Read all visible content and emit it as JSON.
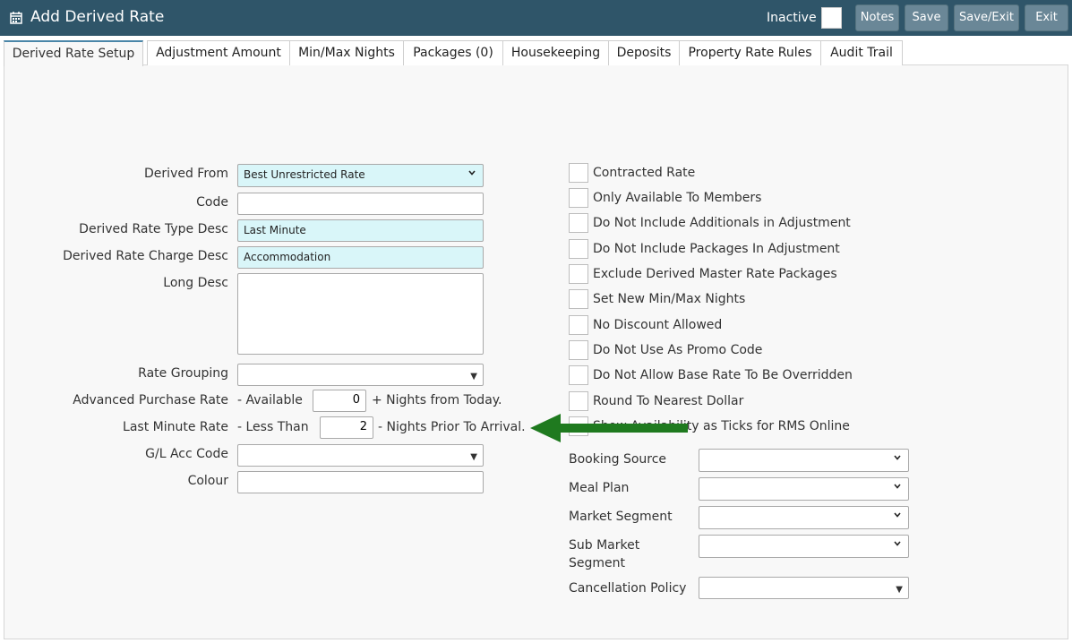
{
  "header": {
    "title": "Add Derived Rate",
    "inactive_label": "Inactive",
    "buttons": {
      "notes": "Notes",
      "save": "Save",
      "save_exit": "Save/Exit",
      "exit": "Exit"
    }
  },
  "tabs": [
    "Derived Rate Setup",
    "Adjustment Amount",
    "Min/Max Nights",
    "Packages (0)",
    "Housekeeping",
    "Deposits",
    "Property Rate Rules",
    "Audit Trail"
  ],
  "form": {
    "derived_from": {
      "label": "Derived From",
      "value": "Best Unrestricted Rate"
    },
    "code": {
      "label": "Code",
      "value": ""
    },
    "type_desc": {
      "label": "Derived Rate Type Desc",
      "value": "Last Minute"
    },
    "charge_desc": {
      "label": "Derived Rate Charge Desc",
      "value": "Accommodation"
    },
    "long_desc": {
      "label": "Long Desc",
      "value": ""
    },
    "rate_grouping": {
      "label": "Rate Grouping",
      "value": ""
    },
    "adv_purchase": {
      "label": "Advanced Purchase Rate",
      "prefix": "- Available",
      "value": "0",
      "suffix": "+ Nights from Today."
    },
    "last_minute": {
      "label": "Last Minute Rate",
      "prefix": "- Less Than",
      "value": "2",
      "suffix": "- Nights Prior To Arrival."
    },
    "gl_code": {
      "label": "G/L Acc Code",
      "value": ""
    },
    "colour": {
      "label": "Colour",
      "value": ""
    }
  },
  "checkboxes": [
    "Contracted Rate",
    "Only Available To Members",
    "Do Not Include Additionals in Adjustment",
    "Do Not Include Packages In Adjustment",
    "Exclude Derived Master Rate Packages",
    "Set New Min/Max Nights",
    "No Discount Allowed",
    "Do Not Use As Promo Code",
    "Do Not Allow Base Rate To Be Overridden",
    "Round To Nearest Dollar",
    "Show Availability as Ticks for RMS Online"
  ],
  "right_selects": {
    "booking_source": "Booking Source",
    "meal_plan": "Meal Plan",
    "market_segment": "Market Segment",
    "sub_market_1": "Sub Market",
    "sub_market_2": "Segment",
    "cancellation": "Cancellation Policy"
  },
  "colors": {
    "header": "#2f5569",
    "cyan_field": "#d9f6f9",
    "arrow": "#1f7a1f"
  }
}
